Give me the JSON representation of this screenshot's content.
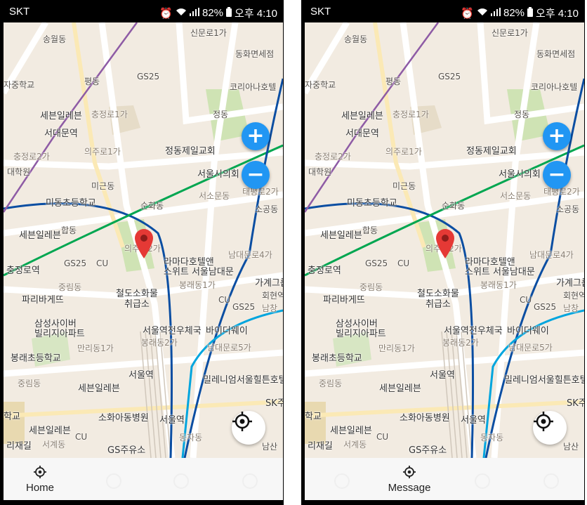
{
  "screens": [
    {
      "status": {
        "carrier": "SKT",
        "battery": "82%",
        "time": "오후 4:10"
      },
      "map": {
        "labels": {
          "l1": "신문로1가",
          "l2": "송월동",
          "l3": "동화면세점",
          "l4": "GS25",
          "l5": "자중학교",
          "l6": "평동",
          "l7": "코리아나호텔",
          "l8": "세븐일레븐",
          "l9": "충정로1가",
          "l10": "정동",
          "l11": "서대문역",
          "l12": "덕수",
          "l13": "충정로2가",
          "l14": "의주로1가",
          "l15": "정동제일교회",
          "l16": "대학원",
          "l17": "서울시의회",
          "l18": "미근동",
          "l19": "태평로2가",
          "l20": "서소문동",
          "l21": "미동초등학교",
          "l22": "순화동",
          "l23": "소공동",
          "l24": "세븐일레븐",
          "l25": "합동",
          "l26": "의주로2가",
          "l27": "라마다호텔앤",
          "l28": "스위트 서울남대문",
          "l29": "남대문로4가",
          "l30": "충정로역",
          "l31": "GS25",
          "l32": "CU",
          "l33": "중림동",
          "l34": "봉래동1가",
          "l35": "가계그룹",
          "l36": "파리바게뜨",
          "l37": "철도소화물",
          "l38": "취급소",
          "l39": "회현역",
          "l40": "CU",
          "l41": "GS25",
          "l42": "남창",
          "l43": "삼성사이버",
          "l44": "빌리지아파트",
          "l45": "서울역전우체국",
          "l46": "바이더웨이",
          "l47": "만리동1가",
          "l48": "봉래동2가",
          "l49": "남대문로5가",
          "l50": "봉래초등학교",
          "l51": "서울역",
          "l52": "밀레니엄서울힐튼호텔",
          "l53": "중림동",
          "l54": "세븐일레븐",
          "l55": "SK주",
          "l56": "학교",
          "l57": "소화아동병원",
          "l58": "서울역",
          "l59": "세븐일레븐",
          "l60": "CU",
          "l61": "서계동",
          "l62": "동자동",
          "l63": "리재길",
          "l64": "GS주유소",
          "l65": "남산"
        }
      },
      "zoom": {
        "in_label": "+",
        "out_label": "−"
      },
      "bottom_nav": {
        "active_label": "Home"
      }
    },
    {
      "status": {
        "carrier": "SKT",
        "battery": "82%",
        "time": "오후 4:10"
      },
      "map": {
        "labels": {
          "l1": "신문로1가",
          "l2": "송월동",
          "l3": "동화면세점",
          "l4": "GS25",
          "l5": "자중학교",
          "l6": "평동",
          "l7": "코리아나호텔",
          "l8": "세븐일레븐",
          "l9": "충정로1가",
          "l10": "정동",
          "l11": "서대문역",
          "l12": "덕수",
          "l13": "충정로2가",
          "l14": "의주로1가",
          "l15": "정동제일교회",
          "l16": "대학원",
          "l17": "서울시의회",
          "l18": "미근동",
          "l19": "태평로2가",
          "l20": "서소문동",
          "l21": "미동초등학교",
          "l22": "순화동",
          "l23": "소공동",
          "l24": "세븐일레븐",
          "l25": "합동",
          "l26": "의주로2가",
          "l27": "라마다호텔앤",
          "l28": "스위트 서울남대문",
          "l29": "남대문로4가",
          "l30": "충정로역",
          "l31": "GS25",
          "l32": "CU",
          "l33": "중림동",
          "l34": "봉래동1가",
          "l35": "가계그룹",
          "l36": "파리바게뜨",
          "l37": "철도소화물",
          "l38": "취급소",
          "l39": "회현역",
          "l40": "CU",
          "l41": "GS25",
          "l42": "남창",
          "l43": "삼성사이버",
          "l44": "빌리지아파트",
          "l45": "서울역전우체국",
          "l46": "바이더웨이",
          "l47": "만리동1가",
          "l48": "봉래동2가",
          "l49": "남대문로5가",
          "l50": "봉래초등학교",
          "l51": "서울역",
          "l52": "밀레니엄서울힐튼호텔",
          "l53": "중림동",
          "l54": "세븐일레븐",
          "l55": "SK주",
          "l56": "학교",
          "l57": "소화아동병원",
          "l58": "서울역",
          "l59": "세븐일레븐",
          "l60": "CU",
          "l61": "서계동",
          "l62": "동자동",
          "l63": "리재길",
          "l64": "GS주유소",
          "l65": "남산"
        }
      },
      "zoom": {
        "in_label": "+",
        "out_label": "−"
      },
      "bottom_nav": {
        "active_label": "Message"
      }
    }
  ],
  "colors": {
    "accent": "#2196f3",
    "pin": "#e53935",
    "map_background": "#f2ebe1",
    "park": "#cfe3b4",
    "subway_line_1": "#0b4ea2",
    "subway_line_2": "#00a650",
    "subway_line_4": "#00a5de",
    "airport_line": "#8e5ba5"
  },
  "icons": [
    "battery-icon",
    "signal-icon",
    "wifi-icon",
    "alarm-icon",
    "plus-icon",
    "minus-icon",
    "crosshair-icon",
    "location-pin-icon",
    "locate-icon",
    "subway-icon"
  ]
}
